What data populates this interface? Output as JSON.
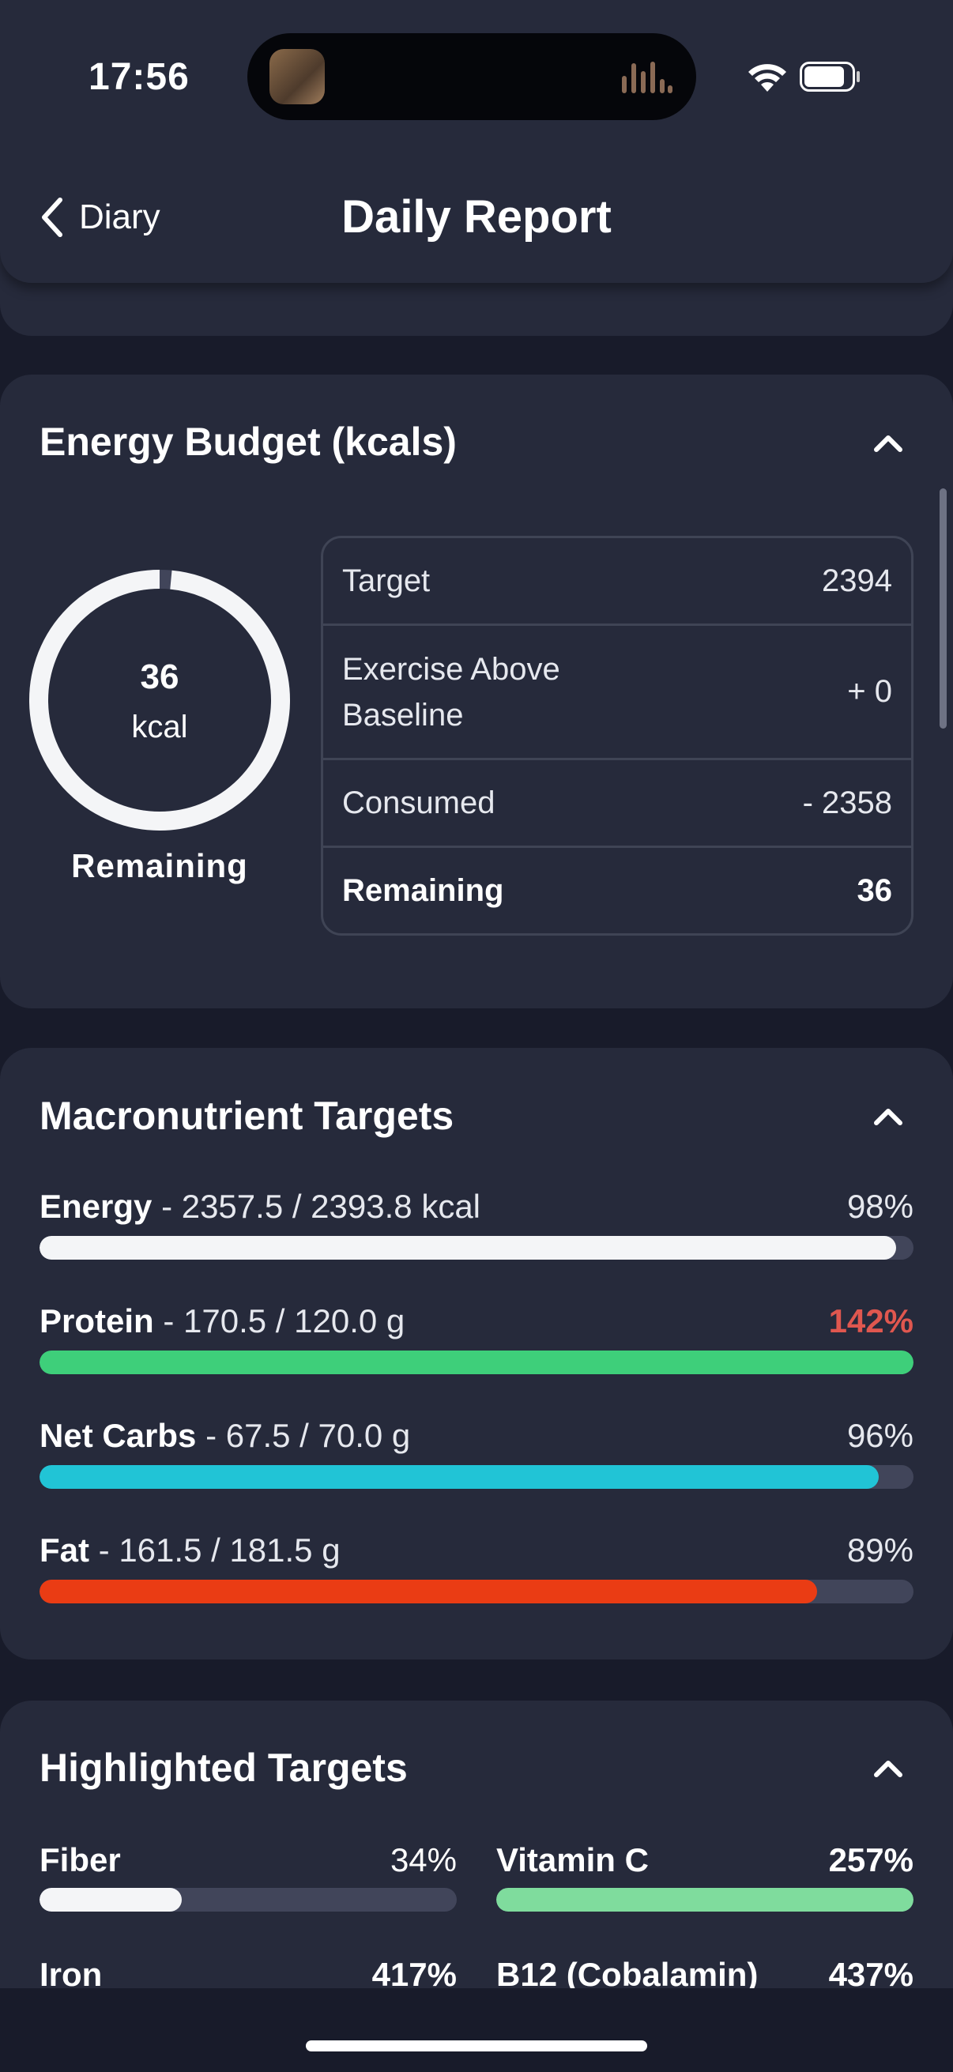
{
  "status_bar": {
    "time": "17:56"
  },
  "nav": {
    "back_label": "Diary",
    "title": "Daily Report"
  },
  "energy": {
    "title": "Energy Budget (kcals)",
    "ring_value": "36",
    "ring_unit": "kcal",
    "ring_label": "Remaining",
    "ring_fraction": 0.985,
    "rows": [
      {
        "label": "Target",
        "value": "2394"
      },
      {
        "label": "Exercise Above Baseline",
        "value": "+ 0"
      },
      {
        "label": "Consumed",
        "value": "- 2358"
      },
      {
        "label": "Remaining",
        "value": "36"
      }
    ]
  },
  "macros": {
    "title": "Macronutrient Targets",
    "items": [
      {
        "name": "Energy",
        "detail": "- 2357.5 / 2393.8 kcal",
        "percent": "98%",
        "fill": 0.98,
        "color": "#f4f5f7"
      },
      {
        "name": "Protein",
        "detail": "- 170.5 / 120.0 g",
        "percent": "142%",
        "fill": 1.0,
        "color": "#3ecf7a",
        "pct_color": "#e0574f"
      },
      {
        "name": "Net Carbs",
        "detail": "- 67.5 / 70.0 g",
        "percent": "96%",
        "fill": 0.96,
        "color": "#21c4d6"
      },
      {
        "name": "Fat",
        "detail": "- 161.5 / 181.5 g",
        "percent": "89%",
        "fill": 0.89,
        "color": "#ea3c14"
      }
    ]
  },
  "highlighted": {
    "title": "Highlighted Targets",
    "items": [
      {
        "name": "Fiber",
        "percent": "34%",
        "fill": 0.34,
        "color": "#f4f5f7"
      },
      {
        "name": "Vitamin C",
        "percent": "257%",
        "fill": 1.0,
        "color": "#7fdc9d"
      },
      {
        "name": "Iron",
        "percent": "417%",
        "fill": 1.0,
        "color": "#7fdc9d"
      },
      {
        "name": "B12 (Cobalamin)",
        "percent": "437%",
        "fill": 1.0,
        "color": "#7fdc9d"
      }
    ]
  }
}
